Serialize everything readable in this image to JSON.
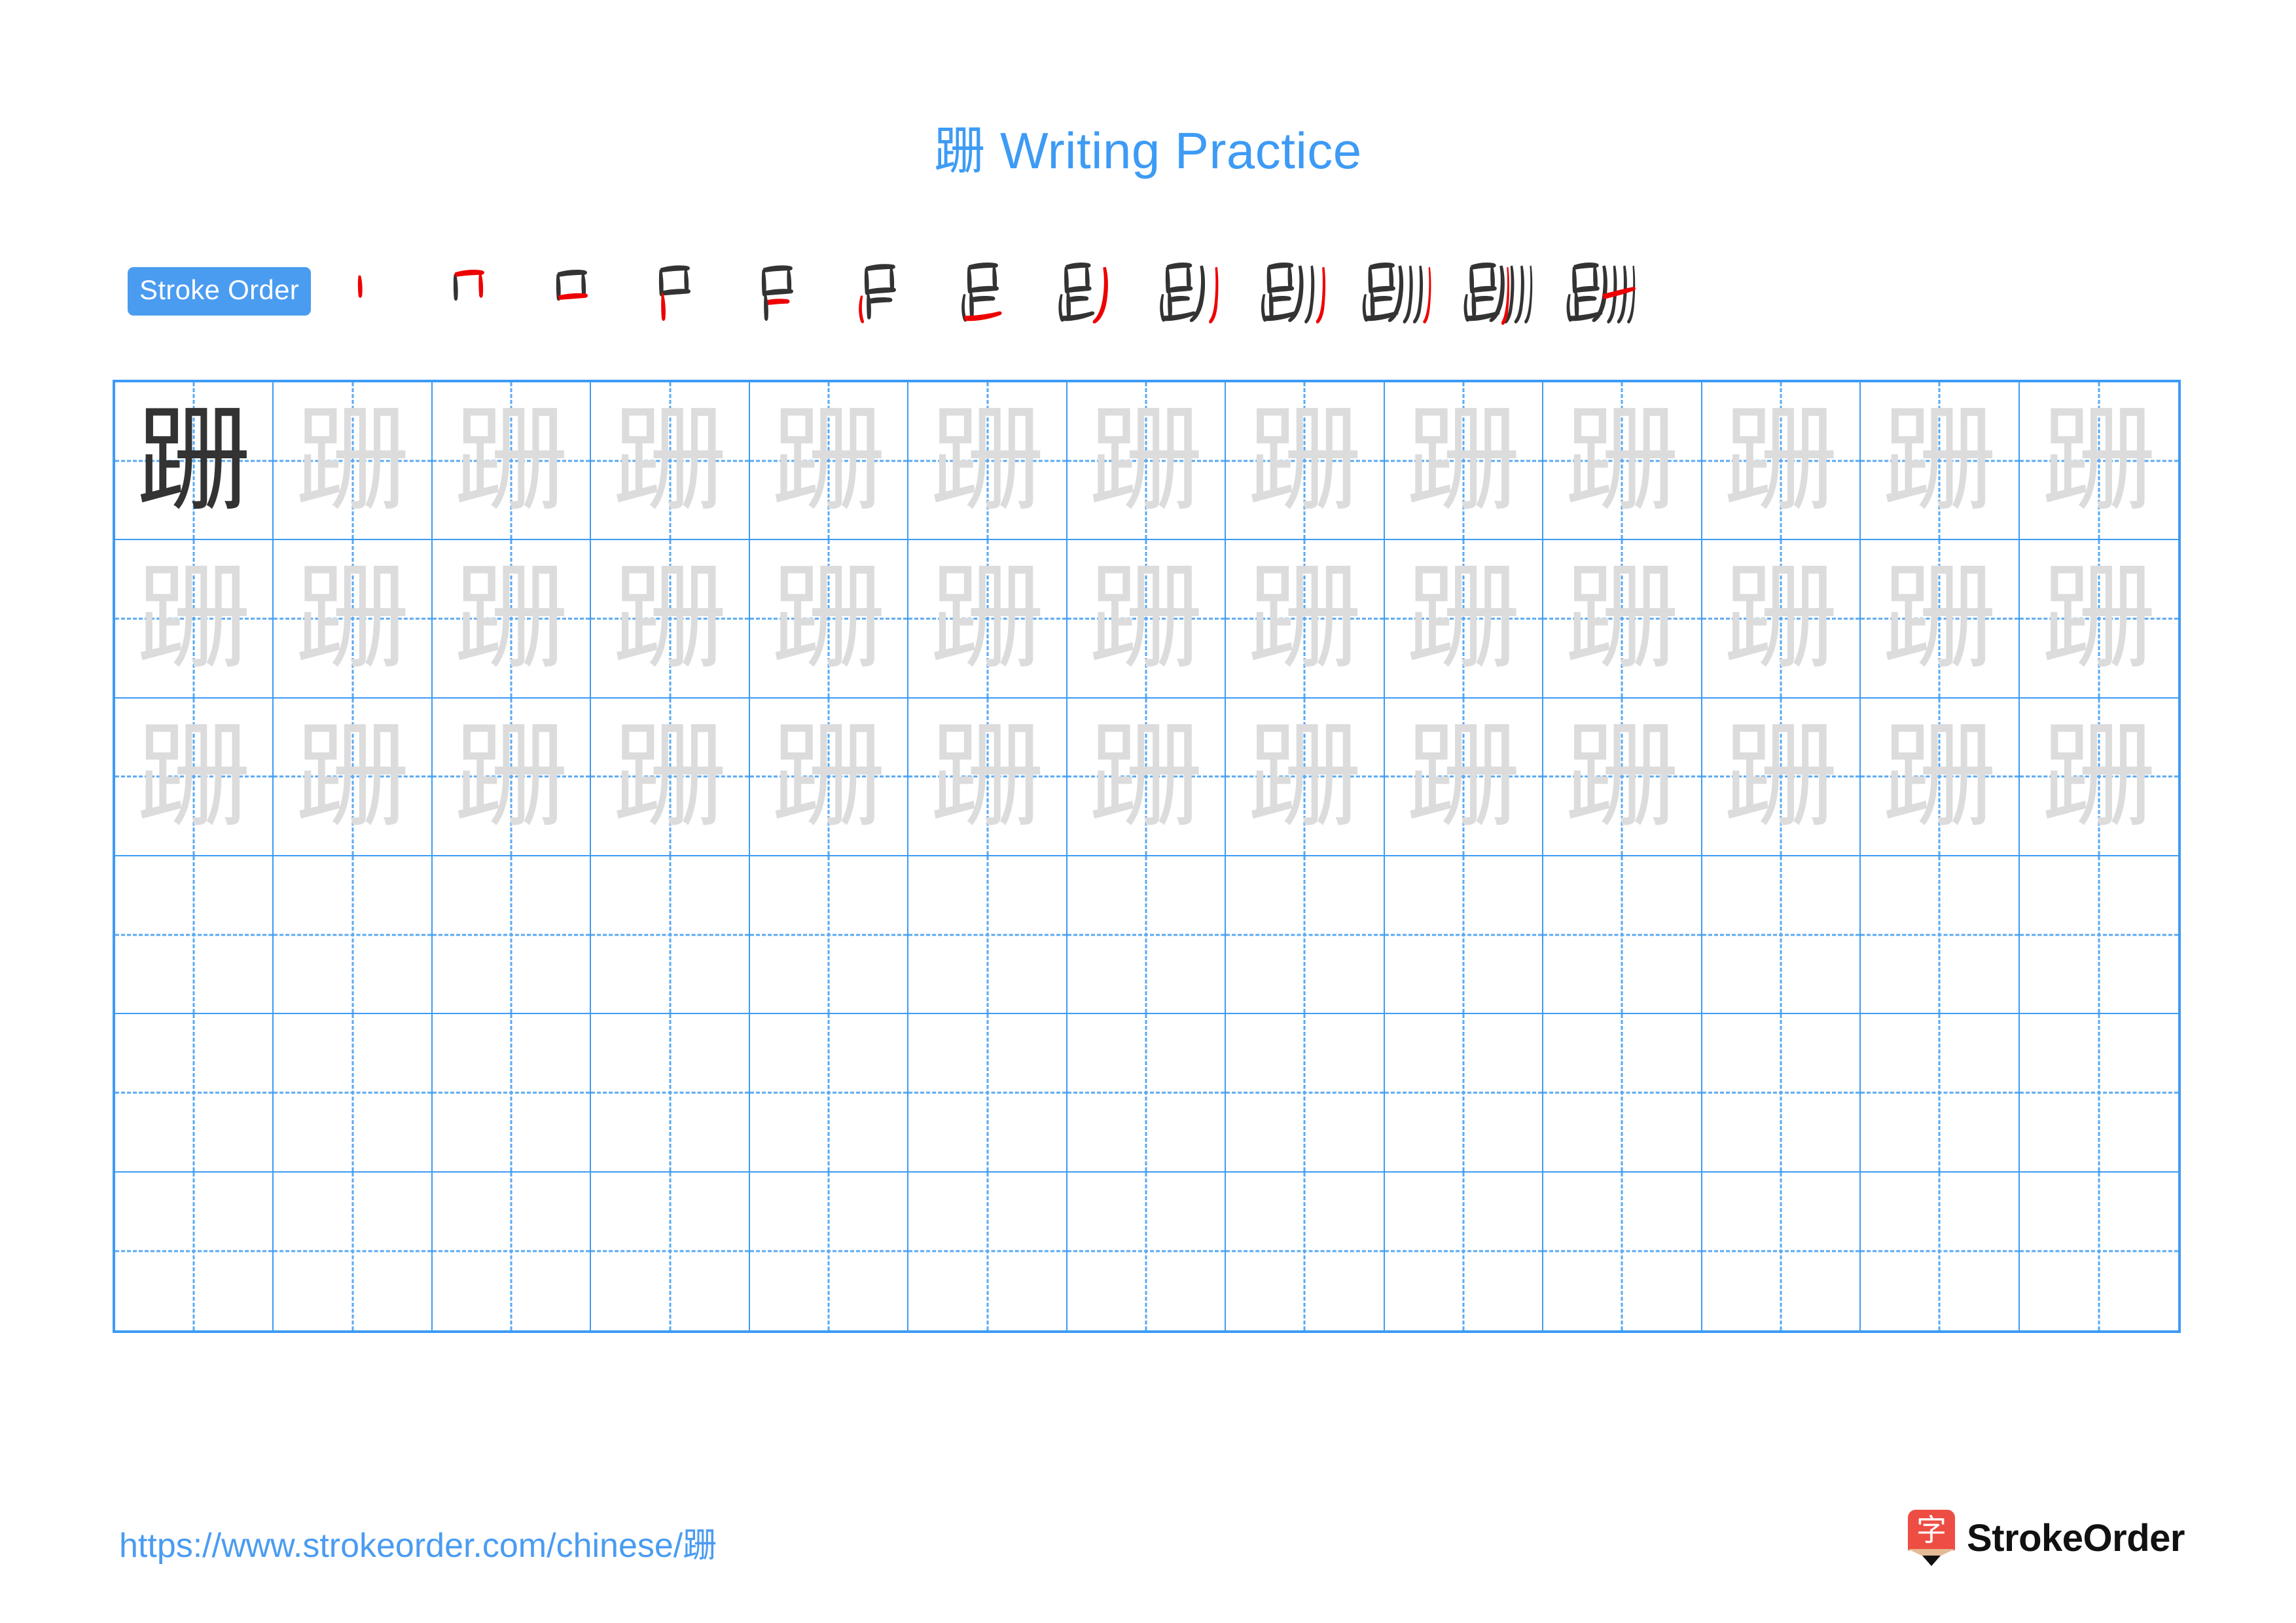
{
  "title": {
    "character": "跚",
    "text": " Writing Practice",
    "color": "#3d9bf5"
  },
  "stroke_order": {
    "badge_label": "Stroke Order",
    "badge_bg": "#4a9cf0",
    "badge_text_color": "#ffffff",
    "highlight_color": "#ee0000",
    "ink_color": "#333333",
    "total_strokes": 13,
    "steps": [
      {
        "index": 1,
        "partial": "丨"
      },
      {
        "index": 2,
        "partial": "冂"
      },
      {
        "index": 3,
        "partial": "口"
      },
      {
        "index": 4,
        "partial": "卩"
      },
      {
        "index": 5,
        "partial": "𧇚"
      },
      {
        "index": 6,
        "partial": "𫩏"
      },
      {
        "index": 7,
        "partial": "足"
      },
      {
        "index": 8,
        "partial": "𧾷丿"
      },
      {
        "index": 9,
        "partial": "𧾷刀"
      },
      {
        "index": 10,
        "partial": "𧾷冂"
      },
      {
        "index": 11,
        "partial": "𧾷冊"
      },
      {
        "index": 12,
        "partial": "𧾷𠕁"
      },
      {
        "index": 13,
        "partial": "跚"
      }
    ]
  },
  "practice_grid": {
    "columns": 13,
    "rows": 6,
    "grid_line_color": "#3d9bf5",
    "guide_line_color": "#5aa9f2",
    "model_char_color": "#333333",
    "trace_char_color": "#dcdcdc",
    "character": "跚",
    "cells": [
      [
        "model",
        "trace",
        "trace",
        "trace",
        "trace",
        "trace",
        "trace",
        "trace",
        "trace",
        "trace",
        "trace",
        "trace",
        "trace"
      ],
      [
        "trace",
        "trace",
        "trace",
        "trace",
        "trace",
        "trace",
        "trace",
        "trace",
        "trace",
        "trace",
        "trace",
        "trace",
        "trace"
      ],
      [
        "trace",
        "trace",
        "trace",
        "trace",
        "trace",
        "trace",
        "trace",
        "trace",
        "trace",
        "trace",
        "trace",
        "trace",
        "trace"
      ],
      [
        "empty",
        "empty",
        "empty",
        "empty",
        "empty",
        "empty",
        "empty",
        "empty",
        "empty",
        "empty",
        "empty",
        "empty",
        "empty"
      ],
      [
        "empty",
        "empty",
        "empty",
        "empty",
        "empty",
        "empty",
        "empty",
        "empty",
        "empty",
        "empty",
        "empty",
        "empty",
        "empty"
      ],
      [
        "empty",
        "empty",
        "empty",
        "empty",
        "empty",
        "empty",
        "empty",
        "empty",
        "empty",
        "empty",
        "empty",
        "empty",
        "empty"
      ]
    ]
  },
  "footer": {
    "url_prefix": "https://www.strokeorder.com/chinese/",
    "url_character": "跚",
    "url_color": "#4a9cf0",
    "brand_name": "StrokeOrder",
    "brand_glyph": "字",
    "brand_mark_color": "#ee4d43"
  }
}
